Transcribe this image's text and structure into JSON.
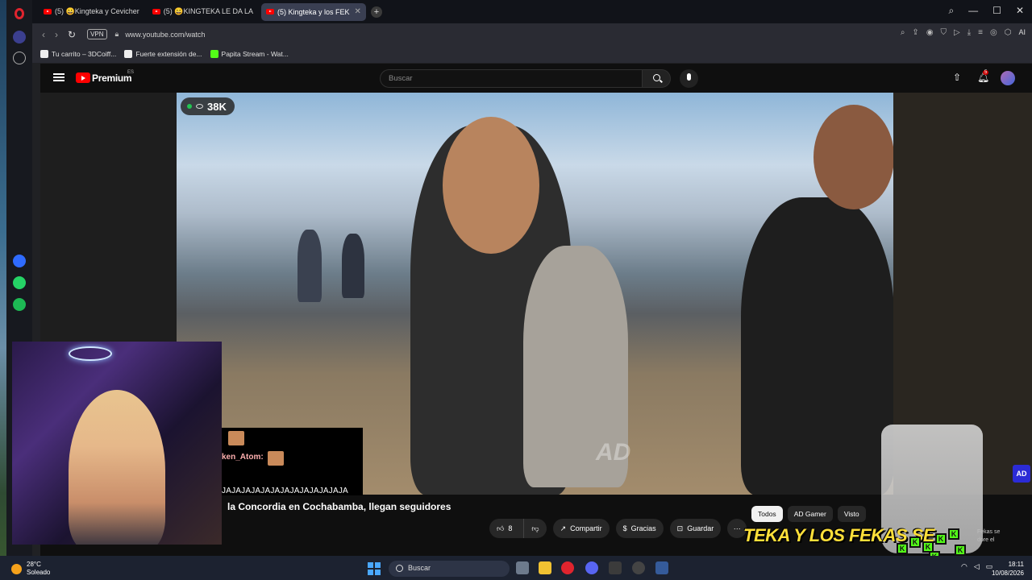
{
  "browser": {
    "tabs": [
      {
        "label": "(5) 😀Kingteka y Cevicher",
        "active": false
      },
      {
        "label": "(5) 😀KINGTEKA LE DA LA",
        "active": false
      },
      {
        "label": "(5) Kingteka y los FEK",
        "active": true
      }
    ],
    "new_tab": "+",
    "window_controls": {
      "search": "⌕",
      "minimize": "—",
      "maximize": "☐",
      "close": "✕"
    },
    "address": {
      "vpn": "VPN",
      "url": "www.youtube.com/watch",
      "ai": "AI"
    },
    "bookmarks": [
      {
        "label": "Tu carrito – 3DCoiff..."
      },
      {
        "label": "Fuerte extensión de..."
      },
      {
        "label": "Papita Stream - Wat..."
      }
    ]
  },
  "youtube": {
    "brand": "Premium",
    "region": "ES",
    "search_placeholder": "Buscar",
    "notifications": "5",
    "video": {
      "viewers": "38K",
      "watermark": "AD",
      "title": "la Concordia en Cochabamba, llegan seguidores"
    },
    "actions": {
      "likes": "8",
      "share": "Compartir",
      "thanks": "Gracias",
      "save": "Guardar",
      "more": "···"
    },
    "chips": [
      "Todos",
      "AD Gamer",
      "Visto"
    ],
    "side_text": "Fekas se\ndore el"
  },
  "stream_overlay": {
    "chat_user": "ken_Atom:",
    "chat_message": "JAJAJAJAJAJAJAJAJAJAJAJAJA",
    "banner": "TEKA Y LOS FEKAS SE",
    "ad_badge": "AD"
  },
  "taskbar": {
    "weather_temp": "28°C",
    "weather_desc": "Soleado",
    "search": "Buscar",
    "time": "18:11",
    "date": "10/08/2026"
  },
  "colors": {
    "accent_red": "#ff0000",
    "kick_green": "#53fc18",
    "banner_yellow": "#ffe03a"
  }
}
